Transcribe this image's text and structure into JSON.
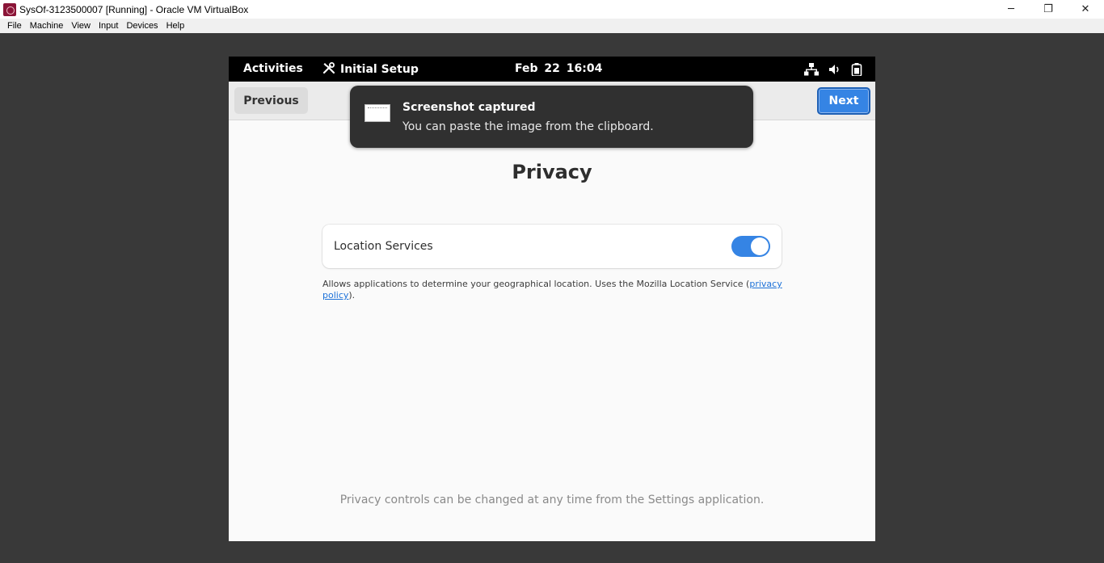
{
  "window": {
    "title": "SysOf-3123500007 [Running] - Oracle VM VirtualBox",
    "controls": {
      "minimize": "─",
      "restore": "❐",
      "close": "✕"
    }
  },
  "menubar": {
    "items": [
      "File",
      "Machine",
      "View",
      "Input",
      "Devices",
      "Help"
    ]
  },
  "topbar": {
    "activities": "Activities",
    "app_menu": "Initial Setup",
    "clock": "Feb 22  16:04",
    "tray_icons": [
      "network-icon",
      "volume-icon",
      "battery-icon"
    ]
  },
  "headerbar": {
    "previous_label": "Previous",
    "next_label": "Next"
  },
  "notification": {
    "title": "Screenshot captured",
    "body": "You can paste the image from the clipboard."
  },
  "page": {
    "title": "Privacy",
    "location_label": "Location Services",
    "location_enabled": true,
    "description_text": "Allows applications to determine your geographical location. Uses the Mozilla Location Service (",
    "description_link": "privacy policy",
    "description_end": ").",
    "footer_note": "Privacy controls can be changed at any time from the Settings application."
  },
  "colors": {
    "accent": "#3584e4",
    "topbar": "#000000",
    "notification": "#303030",
    "link": "#1c71d8"
  }
}
